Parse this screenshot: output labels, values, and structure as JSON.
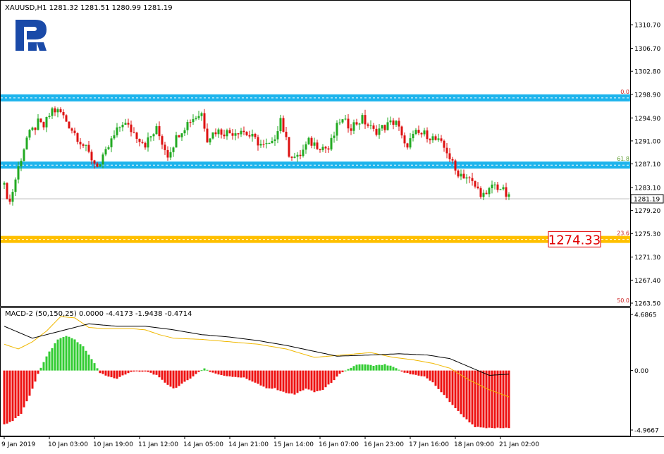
{
  "header": {
    "symbol_info": "XAUUSD,H1  1281.32 1281.51 1280.99 1281.19",
    "macd_info": "MACD-2 (50,150,25) 0.0000 -4.4173 -1.9438 -0.4714"
  },
  "colors": {
    "bull": "#22aa22",
    "bear": "#dd1111",
    "macd_pos": "#33cc33",
    "macd_neg": "#ee1111",
    "fib_band": "#1eb4ec",
    "target_band": "#ffc000",
    "target_label": "#e00000",
    "signal_line": "#000000",
    "macd_line": "#f0b800",
    "logo": "#1a4aa8"
  },
  "chart_data": [
    {
      "type": "candlestick",
      "series_name": "XAUUSD,H1",
      "ylim": [
        1263.5,
        1312.5
      ],
      "price_ticks": [
        "1310.70",
        "1306.70",
        "1302.80",
        "1298.90",
        "1294.90",
        "1291.00",
        "1287.10",
        "1283.10",
        "1279.20",
        "1275.30",
        "1271.30",
        "1267.40",
        "1263.50"
      ],
      "current_price": "1281.19",
      "target_price": "1274.33",
      "fib_levels": [
        {
          "label": "0.0",
          "price": 1298.3
        },
        {
          "label": "61.8",
          "price": 1286.9
        },
        {
          "label": "23.6",
          "price": 1274.3
        },
        {
          "label": "50.0",
          "price": 1263.5
        }
      ],
      "x_labels": [
        "9 Jan 2019",
        "10 Jan 03:00",
        "10 Jan 19:00",
        "11 Jan 12:00",
        "14 Jan 05:00",
        "14 Jan 21:00",
        "15 Jan 14:00",
        "16 Jan 07:00",
        "16 Jan 23:00",
        "17 Jan 16:00",
        "18 Jan 09:00",
        "21 Jan 02:00"
      ],
      "x_label_bars": [
        0,
        16,
        32,
        48,
        64,
        80,
        96,
        112,
        128,
        144,
        160,
        176
      ],
      "close_anchors": [
        [
          0,
          1283.2
        ],
        [
          2,
          1280.6
        ],
        [
          5,
          1286.5
        ],
        [
          8,
          1291.5
        ],
        [
          12,
          1294.0
        ],
        [
          14,
          1293.4
        ],
        [
          17,
          1296.3
        ],
        [
          20,
          1295.8
        ],
        [
          24,
          1293.0
        ],
        [
          28,
          1290.3
        ],
        [
          32,
          1287.3
        ],
        [
          34,
          1286.9
        ],
        [
          38,
          1291.0
        ],
        [
          42,
          1294.2
        ],
        [
          46,
          1292.4
        ],
        [
          50,
          1290.5
        ],
        [
          54,
          1292.9
        ],
        [
          58,
          1288.7
        ],
        [
          62,
          1292.4
        ],
        [
          66,
          1294.6
        ],
        [
          70,
          1295.7
        ],
        [
          72,
          1291.5
        ],
        [
          75,
          1292.7
        ],
        [
          80,
          1292.4
        ],
        [
          84,
          1292.9
        ],
        [
          88,
          1291.5
        ],
        [
          92,
          1290.1
        ],
        [
          95,
          1290.3
        ],
        [
          98,
          1294.9
        ],
        [
          101,
          1289.0
        ],
        [
          104,
          1288.0
        ],
        [
          108,
          1290.8
        ],
        [
          112,
          1290.2
        ],
        [
          115,
          1289.6
        ],
        [
          119,
          1294.5
        ],
        [
          123,
          1293.5
        ],
        [
          127,
          1294.7
        ],
        [
          131,
          1292.6
        ],
        [
          135,
          1293.4
        ],
        [
          139,
          1294.5
        ],
        [
          142,
          1290.0
        ],
        [
          146,
          1292.2
        ],
        [
          150,
          1292.1
        ],
        [
          154,
          1290.8
        ],
        [
          157,
          1289.3
        ],
        [
          160,
          1285.9
        ],
        [
          164,
          1284.9
        ],
        [
          168,
          1282.7
        ],
        [
          171,
          1281.4
        ],
        [
          173,
          1283.6
        ],
        [
          176,
          1283.0
        ],
        [
          179,
          1281.2
        ]
      ]
    },
    {
      "type": "histogram",
      "series_name": "MACD-2 (50,150,25)",
      "ylim": [
        -4.9667,
        4.6865
      ],
      "ticks": [
        "4.6865",
        "0.00",
        "-4.9667"
      ],
      "hist_anchors": [
        [
          0,
          -4.5
        ],
        [
          3,
          -4.2
        ],
        [
          6,
          -3.6
        ],
        [
          9,
          -2.1
        ],
        [
          12,
          -0.3
        ],
        [
          15,
          1.2
        ],
        [
          19,
          2.6
        ],
        [
          22,
          2.9
        ],
        [
          25,
          2.6
        ],
        [
          28,
          2.0
        ],
        [
          32,
          0.6
        ],
        [
          34,
          -0.2
        ],
        [
          37,
          -0.5
        ],
        [
          40,
          -0.7
        ],
        [
          42,
          -0.4
        ],
        [
          45,
          -0.1
        ],
        [
          48,
          -0.1
        ],
        [
          51,
          -0.1
        ],
        [
          54,
          -0.4
        ],
        [
          57,
          -1.0
        ],
        [
          60,
          -1.5
        ],
        [
          62,
          -1.3
        ],
        [
          65,
          -0.8
        ],
        [
          68,
          -0.3
        ],
        [
          71,
          0.2
        ],
        [
          73,
          -0.1
        ],
        [
          77,
          -0.4
        ],
        [
          81,
          -0.5
        ],
        [
          85,
          -0.6
        ],
        [
          89,
          -1.0
        ],
        [
          93,
          -1.5
        ],
        [
          96,
          -1.5
        ],
        [
          99,
          -1.8
        ],
        [
          103,
          -2.0
        ],
        [
          107,
          -1.5
        ],
        [
          110,
          -1.8
        ],
        [
          113,
          -1.6
        ],
        [
          116,
          -1.0
        ],
        [
          119,
          -0.3
        ],
        [
          122,
          0.1
        ],
        [
          125,
          0.5
        ],
        [
          128,
          0.5
        ],
        [
          131,
          0.4
        ],
        [
          135,
          0.5
        ],
        [
          138,
          0.3
        ],
        [
          141,
          -0.1
        ],
        [
          144,
          -0.3
        ],
        [
          147,
          -0.4
        ],
        [
          149,
          -0.5
        ],
        [
          152,
          -1.0
        ],
        [
          155,
          -1.8
        ],
        [
          158,
          -2.6
        ],
        [
          161,
          -3.4
        ],
        [
          164,
          -4.1
        ],
        [
          167,
          -4.7
        ],
        [
          170,
          -4.8
        ],
        [
          173,
          -4.8
        ],
        [
          176,
          -4.8
        ],
        [
          179,
          -4.8
        ]
      ],
      "signal_anchors": [
        [
          0,
          3.7
        ],
        [
          10,
          2.7
        ],
        [
          20,
          3.3
        ],
        [
          30,
          3.9
        ],
        [
          40,
          3.7
        ],
        [
          50,
          3.7
        ],
        [
          60,
          3.4
        ],
        [
          70,
          3.0
        ],
        [
          80,
          2.8
        ],
        [
          90,
          2.5
        ],
        [
          100,
          2.1
        ],
        [
          110,
          1.6
        ],
        [
          118,
          1.2
        ],
        [
          130,
          1.3
        ],
        [
          140,
          1.4
        ],
        [
          150,
          1.3
        ],
        [
          158,
          1.0
        ],
        [
          166,
          0.2
        ],
        [
          172,
          -0.4
        ],
        [
          179,
          -0.3
        ]
      ],
      "macd_anchors": [
        [
          0,
          2.2
        ],
        [
          5,
          1.8
        ],
        [
          10,
          2.4
        ],
        [
          15,
          3.3
        ],
        [
          20,
          4.5
        ],
        [
          25,
          4.4
        ],
        [
          30,
          3.6
        ],
        [
          35,
          3.5
        ],
        [
          45,
          3.5
        ],
        [
          50,
          3.4
        ],
        [
          55,
          3.0
        ],
        [
          60,
          2.7
        ],
        [
          70,
          2.6
        ],
        [
          80,
          2.4
        ],
        [
          90,
          2.2
        ],
        [
          100,
          1.8
        ],
        [
          110,
          1.1
        ],
        [
          120,
          1.3
        ],
        [
          130,
          1.5
        ],
        [
          138,
          1.1
        ],
        [
          145,
          0.9
        ],
        [
          152,
          0.6
        ],
        [
          158,
          0.2
        ],
        [
          165,
          -0.8
        ],
        [
          172,
          -1.6
        ],
        [
          179,
          -2.2
        ]
      ]
    }
  ]
}
